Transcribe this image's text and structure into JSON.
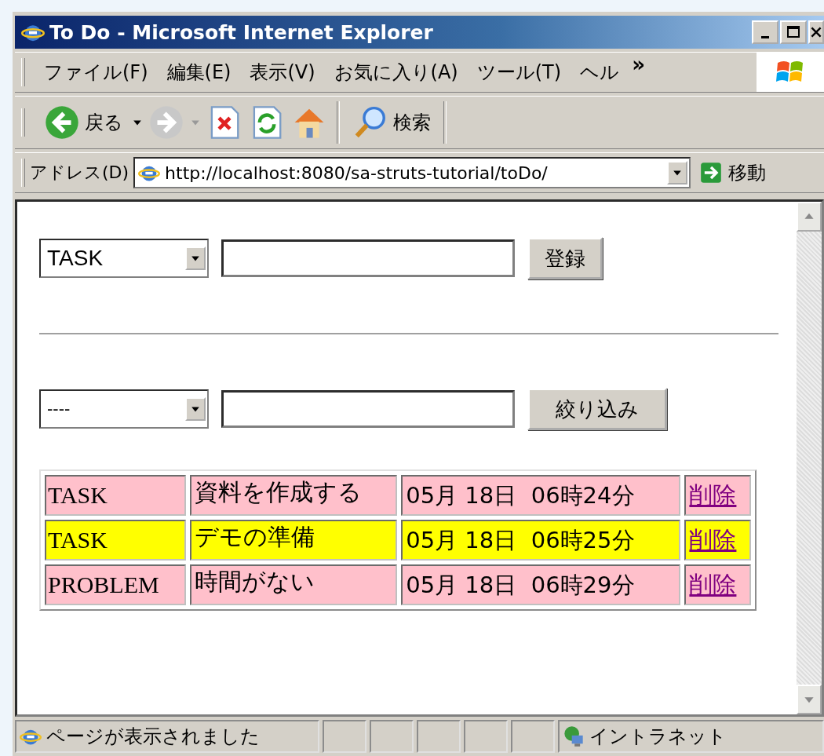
{
  "window": {
    "title": "To Do - Microsoft Internet Explorer"
  },
  "menu": [
    "ファイル(F)",
    "編集(E)",
    "表示(V)",
    "お気に入り(A)",
    "ツール(T)",
    "ヘル"
  ],
  "menu_overflow": "»",
  "toolbar": {
    "back": "戻る",
    "search": "検索"
  },
  "address": {
    "label": "アドレス(D)",
    "url": "http://localhost:8080/sa-struts-tutorial/toDo/",
    "go": "移動"
  },
  "register_form": {
    "type_select": "TASK",
    "button": "登録"
  },
  "filter_form": {
    "type_select": "----",
    "button": "絞り込み"
  },
  "todos": [
    {
      "type": "TASK",
      "content": "資料を作成する",
      "date": "05月 18日  06時24分",
      "delete_link": "削除",
      "color": "#ffc0cb"
    },
    {
      "type": "TASK",
      "content": "デモの準備",
      "date": "05月 18日  06時25分",
      "delete_link": "削除",
      "color": "#ffff00"
    },
    {
      "type": "PROBLEM",
      "content": "時間がない",
      "date": "05月 18日  06時29分",
      "delete_link": "削除",
      "color": "#ffc0cb"
    }
  ],
  "status_bar": {
    "message": "ページが表示されました",
    "zone": "イントラネット"
  }
}
